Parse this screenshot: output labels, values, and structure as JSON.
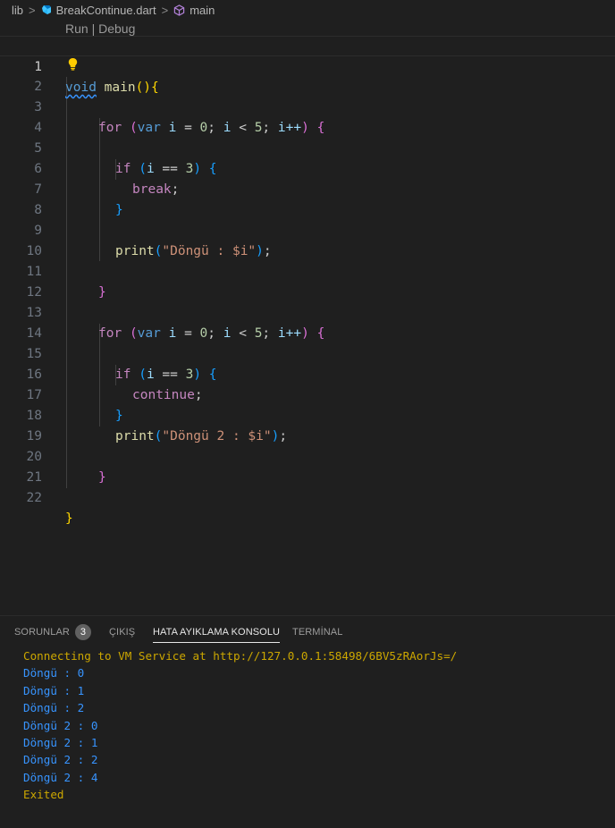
{
  "breadcrumb": {
    "items": [
      "lib",
      "BreakContinue.dart",
      "main"
    ],
    "separator": ">"
  },
  "editor": {
    "codelens": "Run | Debug",
    "line_numbers": [
      "1",
      "2",
      "3",
      "4",
      "5",
      "6",
      "7",
      "8",
      "9",
      "10",
      "11",
      "12",
      "13",
      "14",
      "15",
      "16",
      "17",
      "18",
      "19",
      "20",
      "21",
      "22"
    ],
    "code": {
      "void": "void",
      "main": "main",
      "for": "for",
      "var": "var",
      "i": "i",
      "zero": "0",
      "five": "5",
      "three": "3",
      "if": "if",
      "break": "break",
      "continue": "continue",
      "print": "print",
      "str1": "\"Döngü : $i\"",
      "str2": "\"Döngü 2 : $i\"",
      "incr": "i++"
    }
  },
  "panel": {
    "tabs": [
      {
        "label": "SORUNLAR",
        "badge": "3"
      },
      {
        "label": "ÇIKIŞ"
      },
      {
        "label": "HATA AYIKLAMA KONSOLU",
        "active": true
      },
      {
        "label": "TERMİNAL"
      }
    ],
    "console": [
      {
        "text": "Connecting to VM Service at http://127.0.0.1:58498/6BV5zRAorJs=/",
        "color": "yellow"
      },
      {
        "text": "Döngü : 0",
        "color": "blue"
      },
      {
        "text": "Döngü : 1",
        "color": "blue"
      },
      {
        "text": "Döngü : 2",
        "color": "blue"
      },
      {
        "text": "Döngü 2 : 0",
        "color": "blue"
      },
      {
        "text": "Döngü 2 : 1",
        "color": "blue"
      },
      {
        "text": "Döngü 2 : 2",
        "color": "blue"
      },
      {
        "text": "Döngü 2 : 4",
        "color": "blue"
      },
      {
        "text": "Exited",
        "color": "yellow"
      }
    ]
  },
  "colors": {
    "background": "#1f1f1f",
    "keyword": "#569cd6",
    "control": "#c586c0",
    "function": "#dcdcaa",
    "variable": "#9cdcfe",
    "number": "#b5cea8",
    "string": "#ce9178",
    "console_blue": "#3794ff",
    "console_yellow": "#cca700"
  }
}
